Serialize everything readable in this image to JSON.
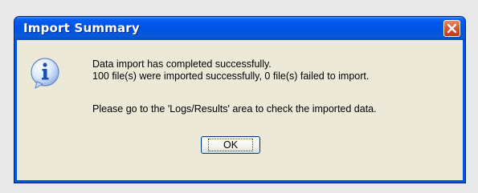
{
  "dialog": {
    "title": "Import Summary",
    "icon": "information-icon",
    "messages": {
      "line1": "Data import has completed successfully.",
      "line2": "100 file(s) were imported successfully, 0  file(s) failed to import.",
      "line3": "Please go to the 'Logs/Results' area to check the imported data."
    },
    "ok_label": "OK",
    "colors": {
      "titlebar": "#0054e3",
      "client": "#ece9d8",
      "close": "#d8572f"
    }
  }
}
